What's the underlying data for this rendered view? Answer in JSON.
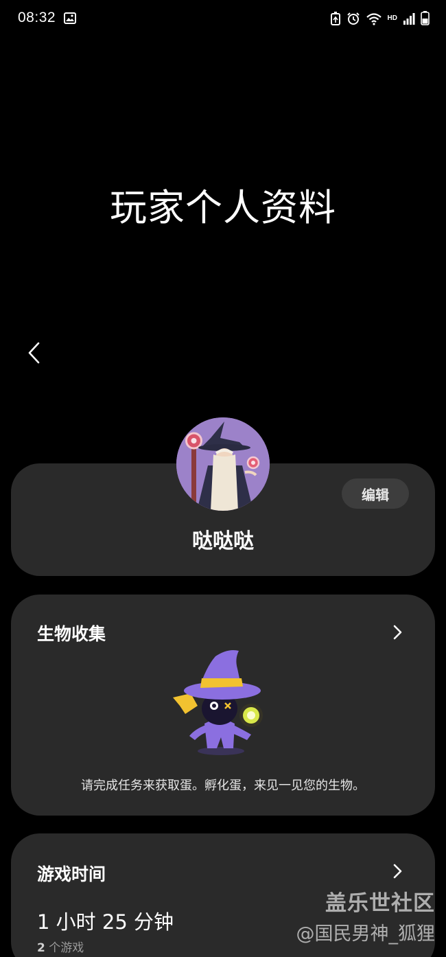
{
  "status_bar": {
    "time": "08:32",
    "network": "HD",
    "icons": [
      "gallery-icon",
      "battery-saver-icon",
      "alarm-icon",
      "wifi-icon",
      "signal-icon",
      "battery-icon"
    ]
  },
  "page": {
    "title": "玩家个人资料",
    "back_icon": "chevron-left-icon"
  },
  "profile": {
    "name": "哒哒哒",
    "edit_label": "编辑",
    "avatar": "wizard-avatar"
  },
  "creatures": {
    "title": "生物收集",
    "hint": "请完成任务来获取蛋。孵化蛋，来见一见您的生物。",
    "image": "purple-witch-creature"
  },
  "playtime": {
    "title": "游戏时间",
    "value": "1 小时 25 分钟",
    "games_count": "2",
    "games_unit": "个游戏"
  },
  "watermark": {
    "site": "盖乐世社区",
    "user": "@国民男神_狐狸"
  },
  "colors": {
    "background": "#000000",
    "card": "#2a2a2a",
    "button": "#3d3d3d",
    "accent_purple": "#8b6fe0",
    "accent_yellow": "#f2c230"
  }
}
